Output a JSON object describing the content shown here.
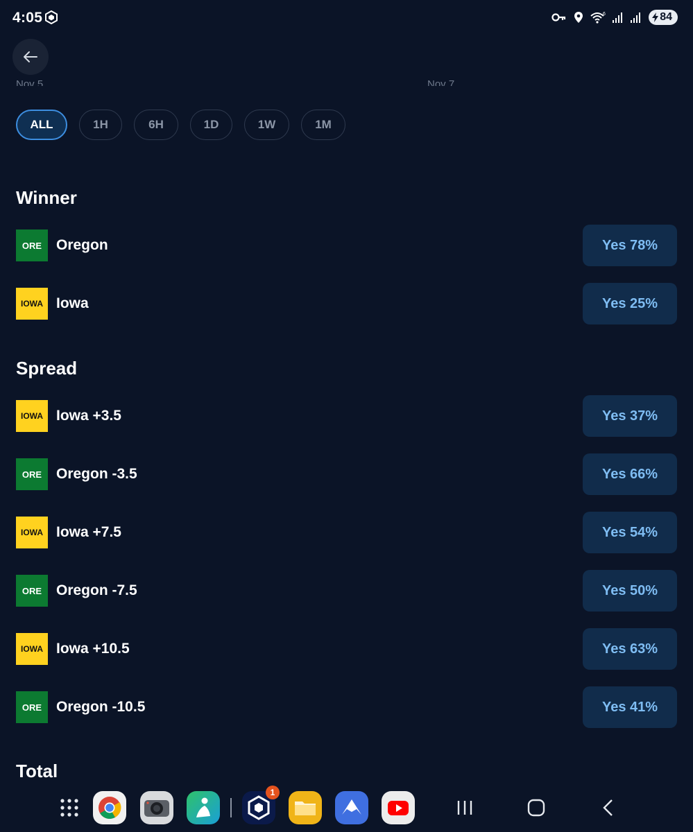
{
  "status_bar": {
    "time": "4:05",
    "battery": "84",
    "icons": [
      "crypto-app-icon",
      "vpn-key-icon",
      "location-icon",
      "wifi-icon",
      "signal-icon",
      "signal-icon",
      "battery-icon"
    ]
  },
  "chart_axis": {
    "dates": [
      "Nov 5",
      "Nov 7"
    ]
  },
  "time_ranges": {
    "options": [
      "ALL",
      "1H",
      "6H",
      "1D",
      "1W",
      "1M"
    ],
    "selected": "ALL"
  },
  "winner": {
    "title": "Winner",
    "rows": [
      {
        "logo": "ORE",
        "label": "Oregon",
        "button": "Yes 78%"
      },
      {
        "logo": "IOWA",
        "label": "Iowa",
        "button": "Yes 25%"
      }
    ]
  },
  "spread": {
    "title": "Spread",
    "rows": [
      {
        "logo": "IOWA",
        "label": "Iowa +3.5",
        "button": "Yes 37%"
      },
      {
        "logo": "ORE",
        "label": "Oregon -3.5",
        "button": "Yes 66%"
      },
      {
        "logo": "IOWA",
        "label": "Iowa +7.5",
        "button": "Yes 54%"
      },
      {
        "logo": "ORE",
        "label": "Oregon -7.5",
        "button": "Yes 50%"
      },
      {
        "logo": "IOWA",
        "label": "Iowa +10.5",
        "button": "Yes 63%"
      },
      {
        "logo": "ORE",
        "label": "Oregon -10.5",
        "button": "Yes 41%"
      }
    ]
  },
  "total": {
    "title": "Total"
  },
  "dock": {
    "apps": [
      "app-drawer-icon",
      "chrome-icon",
      "camera-icon",
      "messenger-icon",
      "crypto-com-icon",
      "files-icon",
      "nordvpn-icon",
      "youtube-icon"
    ],
    "crypto_badge": "1"
  },
  "colors": {
    "background": "#0b1427",
    "yes_button_bg": "#112c4b",
    "yes_button_text": "#7fbdf3",
    "active_pill_border": "#3d8ee0",
    "oregon_green": "#0c7a31",
    "iowa_gold": "#ffd21f"
  }
}
